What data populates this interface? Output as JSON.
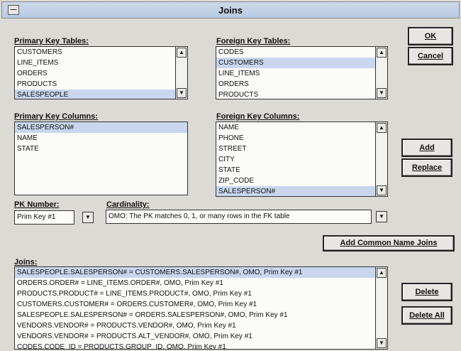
{
  "window": {
    "title": "Joins"
  },
  "primary_key_tables": {
    "label": "Primary Key Tables:",
    "items": [
      "CUSTOMERS",
      "LINE_ITEMS",
      "ORDERS",
      "PRODUCTS",
      "SALESPEOPLE"
    ],
    "selected": 4
  },
  "foreign_key_tables": {
    "label": "Foreign Key Tables:",
    "items": [
      "CODES",
      "CUSTOMERS",
      "LINE_ITEMS",
      "ORDERS",
      "PRODUCTS"
    ],
    "selected": 1
  },
  "primary_key_columns": {
    "label": "Primary Key Columns:",
    "items": [
      "SALESPERSON#",
      "NAME",
      "STATE"
    ],
    "selected": 0
  },
  "foreign_key_columns": {
    "label": "Foreign Key Columns:",
    "items": [
      "NAME",
      "PHONE",
      "STREET",
      "CITY",
      "STATE",
      "ZIP_CODE",
      "SALESPERSON#"
    ],
    "selected": 6
  },
  "pk_number": {
    "label": "PK Number:",
    "value": "Prim Key #1"
  },
  "cardinality": {
    "label": "Cardinality:",
    "value": "OMO: The PK matches 0, 1, or many rows in the FK table"
  },
  "joins": {
    "label": "Joins:",
    "items": [
      "SALESPEOPLE.SALESPERSON# = CUSTOMERS.SALESPERSON#, OMO, Prim Key #1",
      "ORDERS.ORDER# = LINE_ITEMS.ORDER#, OMO, Prim Key #1",
      "PRODUCTS.PRODUCT# = LINE_ITEMS.PRODUCT#, OMO, Prim Key #1",
      "CUSTOMERS.CUSTOMER# = ORDERS.CUSTOMER#, OMO, Prim Key #1",
      "SALESPEOPLE.SALESPERSON# = ORDERS.SALESPERSON#, OMO, Prim Key #1",
      "VENDORS.VENDOR# = PRODUCTS.VENDOR#, OMO, Prim Key #1",
      "VENDORS.VENDOR# = PRODUCTS.ALT_VENDOR#, OMO, Prim Key #1",
      "CODES.CODE_ID = PRODUCTS.GROUP_ID, OMO, Prim Key #1"
    ],
    "selected": 0
  },
  "buttons": {
    "ok": "OK",
    "cancel": "Cancel",
    "add": "Add",
    "replace": "Replace",
    "add_common": "Add Common Name Joins",
    "delete": "Delete",
    "delete_all": "Delete All"
  },
  "icons": {
    "scroll_arrow": "scroll-arrow-icon",
    "system_menu": "system-menu-icon",
    "dropdown": "dropdown-arrow-icon"
  }
}
